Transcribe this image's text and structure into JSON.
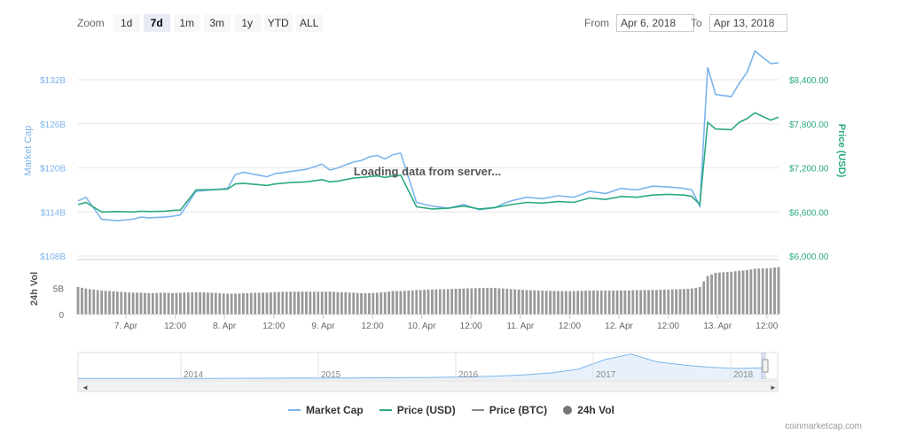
{
  "toolbar": {
    "zoom_label": "Zoom",
    "zoom_buttons": [
      "1d",
      "7d",
      "1m",
      "3m",
      "1y",
      "YTD",
      "ALL"
    ],
    "active_zoom": "7d",
    "from_label": "From",
    "from_value": "Apr 6, 2018",
    "to_label": "To",
    "to_value": "Apr 13, 2018"
  },
  "loading_text": "Loading data from server...",
  "credit": "coinmarketcap.com",
  "colors": {
    "market_cap": "#7cb5ec",
    "price_usd": "#2ba982",
    "price_btc": "#888888",
    "volume": "#999999"
  },
  "chart_data": {
    "type": "line",
    "left_axis": {
      "title": "Market Cap",
      "ticks": [
        "$108B",
        "$114B",
        "$120B",
        "$126B",
        "$132B"
      ],
      "ylim": [
        108,
        132
      ]
    },
    "right_axis": {
      "title": "Price (USD)",
      "ticks": [
        "$6,000.00",
        "$6,600.00",
        "$7,200.00",
        "$7,800.00",
        "$8,400.00"
      ],
      "ylim": [
        6000,
        8400
      ]
    },
    "volume_axis": {
      "title": "24h Vol",
      "ticks": [
        "0",
        "5B"
      ],
      "ylim": [
        0,
        10
      ]
    },
    "x_ticks": [
      "7. Apr",
      "12:00",
      "8. Apr",
      "12:00",
      "9. Apr",
      "12:00",
      "10. Apr",
      "12:00",
      "11. Apr",
      "12:00",
      "12. Apr",
      "12:00",
      "13. Apr",
      "12:00"
    ],
    "x": [
      0,
      2,
      6,
      10,
      14,
      16,
      18,
      22,
      24,
      26,
      30,
      34,
      38,
      40,
      42,
      46,
      48,
      50,
      54,
      58,
      62,
      64,
      66,
      70,
      72,
      74,
      76,
      78,
      80,
      82,
      86,
      90,
      94,
      98,
      102,
      106,
      108,
      110,
      114,
      118,
      122,
      126,
      130,
      134,
      138,
      142,
      146,
      150,
      154,
      156,
      158,
      160,
      162,
      166,
      168,
      170,
      172,
      176,
      178
    ],
    "series": [
      {
        "name": "Market Cap",
        "values": [
          115.5,
          116.0,
          113.0,
          112.8,
          113.0,
          113.3,
          113.2,
          113.3,
          113.4,
          113.6,
          116.8,
          117.0,
          117.2,
          119.1,
          119.4,
          119.0,
          118.8,
          119.2,
          119.5,
          119.8,
          120.5,
          119.7,
          120.0,
          120.8,
          121.0,
          121.5,
          121.7,
          121.2,
          121.8,
          122.0,
          115.3,
          114.8,
          114.5,
          115.0,
          114.3,
          114.6,
          115.1,
          115.5,
          116.0,
          115.8,
          116.2,
          116.0,
          116.8,
          116.5,
          117.2,
          117.0,
          117.5,
          117.4,
          117.2,
          117.0,
          114.8,
          133.7,
          130.0,
          129.7,
          131.5,
          133.0,
          135.9,
          134.2,
          134.3
        ]
      },
      {
        "name": "Price (USD)",
        "values": [
          6700,
          6730,
          6600,
          6605,
          6600,
          6610,
          6605,
          6610,
          6620,
          6625,
          6900,
          6905,
          6910,
          6980,
          6990,
          6970,
          6960,
          6980,
          7000,
          7010,
          7040,
          7010,
          7020,
          7060,
          7070,
          7080,
          7090,
          7070,
          7090,
          7100,
          6670,
          6640,
          6650,
          6680,
          6640,
          6660,
          6680,
          6700,
          6730,
          6720,
          6740,
          6730,
          6790,
          6770,
          6810,
          6800,
          6830,
          6840,
          6830,
          6810,
          6700,
          7820,
          7730,
          7720,
          7820,
          7870,
          7950,
          7850,
          7890
        ]
      },
      {
        "name": "Price (BTC)",
        "values": []
      },
      {
        "name": "24h Vol",
        "values": [
          5.3,
          5.0,
          4.6,
          4.4,
          4.2,
          4.2,
          4.1,
          4.2,
          4.1,
          4.2,
          4.3,
          4.2,
          4.0,
          4.0,
          4.1,
          4.2,
          4.2,
          4.3,
          4.4,
          4.4,
          4.4,
          4.4,
          4.3,
          4.2,
          4.1,
          4.1,
          4.2,
          4.3,
          4.5,
          4.5,
          4.7,
          4.8,
          4.9,
          5.0,
          5.1,
          5.1,
          5.0,
          4.9,
          4.7,
          4.6,
          4.5,
          4.5,
          4.6,
          4.6,
          4.6,
          4.7,
          4.7,
          4.8,
          4.9,
          5.0,
          5.3,
          7.4,
          8.0,
          8.2,
          8.4,
          8.5,
          8.8,
          8.9,
          9.1
        ]
      }
    ],
    "navigator": {
      "years": [
        "2014",
        "2015",
        "2016",
        "2017",
        "2018"
      ],
      "values": [
        2,
        2,
        2,
        2,
        2.2,
        2.3,
        2.5,
        2.7,
        3,
        3.2,
        3.5,
        4,
        4.5,
        5,
        6,
        8,
        10,
        14,
        20,
        32,
        62,
        80,
        55,
        45,
        38,
        34,
        36
      ]
    },
    "legend_position": "bottom",
    "grid": true
  }
}
